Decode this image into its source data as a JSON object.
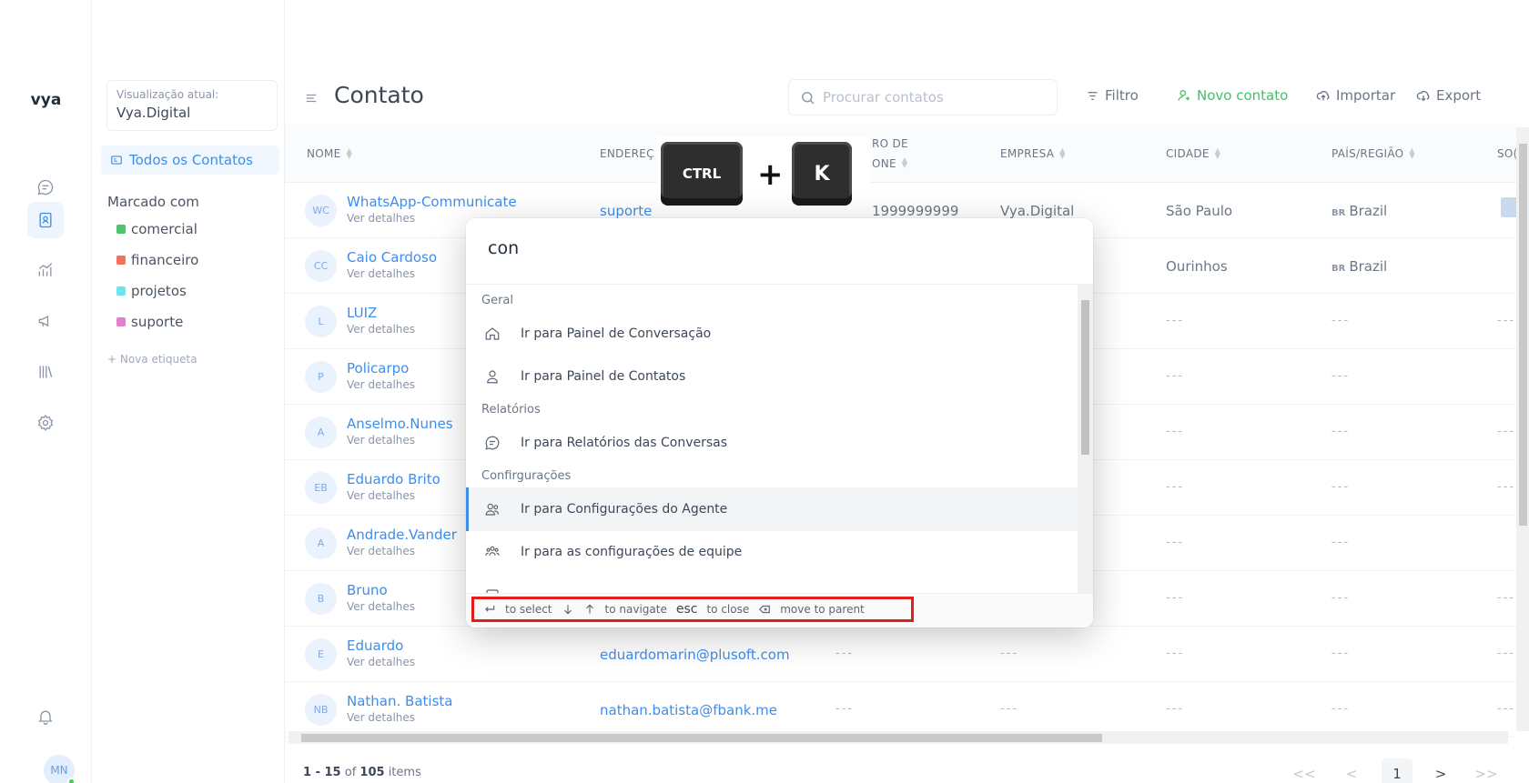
{
  "app": {
    "logo": "vya",
    "user_initials": "MN"
  },
  "sidebar": {
    "view_label": "Visualização atual:",
    "view_value": "Vya.Digital",
    "all_contacts": "Todos os Contatos",
    "tags_title": "Marcado com",
    "tags": [
      {
        "label": "comercial",
        "color": "#4cc66c"
      },
      {
        "label": "financeiro",
        "color": "#f2735b"
      },
      {
        "label": "projetos",
        "color": "#6ee4ee"
      },
      {
        "label": "suporte",
        "color": "#e47fcc"
      }
    ],
    "new_tag": "+ Nova etiqueta"
  },
  "header": {
    "title": "Contato",
    "search_placeholder": "Procurar contatos",
    "filter": "Filtro",
    "new_contact": "Novo contato",
    "import": "Importar",
    "export": "Export"
  },
  "table": {
    "columns": {
      "name": "NOME",
      "email": "ENDEREÇ",
      "phone_1": "RO DE",
      "phone_2": "ONE",
      "company": "EMPRESA",
      "city": "CIDADE",
      "country": "PAÍS/REGIÃO",
      "social": "SO("
    },
    "details_label": "Ver detalhes",
    "rows": [
      {
        "initials": "WC",
        "name": "WhatsApp-Communicate",
        "email": "suporte",
        "phone": "1999999999",
        "company": "Vya.Digital",
        "city": "São Paulo",
        "flag": "BR",
        "country": "Brazil",
        "social": "",
        "has_social": true
      },
      {
        "initials": "CC",
        "name": "Caio Cardoso",
        "email": "",
        "phone": "",
        "company": "",
        "city": "Ourinhos",
        "flag": "BR",
        "country": "Brazil",
        "social": ""
      },
      {
        "initials": "L",
        "name": "LUIZ",
        "email": "",
        "phone": "",
        "company": "",
        "city": "---",
        "flag": "",
        "country": "---",
        "social": "---"
      },
      {
        "initials": "P",
        "name": "Policarpo",
        "email": "",
        "phone": "",
        "company": "",
        "city": "---",
        "flag": "",
        "country": "---",
        "social": ""
      },
      {
        "initials": "A",
        "name": "Anselmo.Nunes",
        "email": "",
        "phone": "",
        "company": "",
        "city": "---",
        "flag": "",
        "country": "---",
        "social": "---"
      },
      {
        "initials": "EB",
        "name": "Eduardo Brito",
        "email": "",
        "phone": "",
        "company": "",
        "city": "---",
        "flag": "",
        "country": "---",
        "social": "---"
      },
      {
        "initials": "A",
        "name": "Andrade.Vander",
        "email": "",
        "phone": "",
        "company": "",
        "city": "---",
        "flag": "",
        "country": "---",
        "social": ""
      },
      {
        "initials": "B",
        "name": "Bruno",
        "email": "",
        "phone": "",
        "company": "",
        "city": "---",
        "flag": "",
        "country": "---",
        "social": "---"
      },
      {
        "initials": "E",
        "name": "Eduardo",
        "email": "eduardomarin@plusoft.com",
        "phone": "---",
        "company": "---",
        "city": "---",
        "flag": "",
        "country": "---",
        "social": "---"
      },
      {
        "initials": "NB",
        "name": "Nathan. Batista",
        "email": "nathan.batista@fbank.me",
        "phone": "---",
        "company": "---",
        "city": "---",
        "flag": "",
        "country": "---",
        "social": "---"
      }
    ]
  },
  "footer": {
    "range": "1 - 15",
    "of": "of",
    "total": "105",
    "items": "items",
    "pager_first": "<<",
    "pager_prev": "<",
    "pager_current": "1",
    "pager_next": ">",
    "pager_last": ">>"
  },
  "shortcut": {
    "key1": "CTRL",
    "plus": "+",
    "key2": "K"
  },
  "palette": {
    "query": "con",
    "groups": {
      "general": "Geral",
      "reports": "Relatórios",
      "settings": "Confirgurações"
    },
    "items": {
      "conversation_panel": "Ir para Painel de Conversação",
      "contacts_panel": "Ir para Painel de Contatos",
      "conversation_reports": "Ir para Relatórios das Conversas",
      "agent_settings": "Ir para Configurações do Agente",
      "team_settings": "Ir para as configurações de equipe"
    },
    "footer": {
      "select": "to select",
      "navigate": "to navigate",
      "esc_key": "esc",
      "close": "to close",
      "parent": "move to parent"
    }
  }
}
